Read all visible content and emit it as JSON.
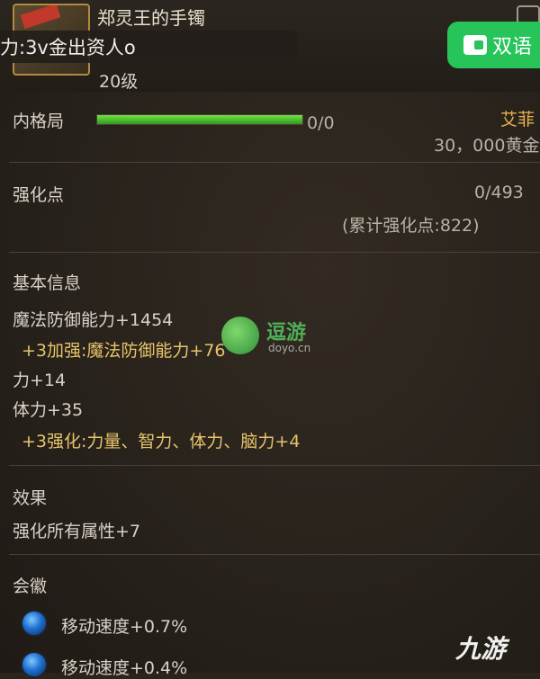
{
  "item": {
    "name": "郑灵王的手镯",
    "level": "20级"
  },
  "overlay": {
    "ad_text": "力:3v金出资人o",
    "translate_label": "双语"
  },
  "inner_pattern": {
    "label": "内格局",
    "progress_text": "0/0",
    "progress_fraction": 1.0
  },
  "merchant": {
    "name": "艾菲",
    "price": "30，000黄金"
  },
  "enhance": {
    "label": "强化点",
    "value": "0/493",
    "cumulative": "(累计强化点:822)"
  },
  "basic_info": {
    "title": "基本信息",
    "stats": [
      "魔法防御能力+1454",
      "+3加强:魔法防御能力+76",
      "力+14",
      "体力+35",
      "+3强化:力量、智力、体力、脑力+4"
    ]
  },
  "effect": {
    "title": "效果",
    "text": "强化所有属性+7"
  },
  "emblem": {
    "title": "会徽",
    "items": [
      "移动速度+0.7%",
      "移动速度+0.4%"
    ]
  },
  "watermarks": {
    "doyo_main": "逗游",
    "doyo_sub": "doyo.cn",
    "nine_you": "九游"
  },
  "colors": {
    "progress_fill": "#4fc72e",
    "bonus_text": "#e6c46a",
    "translate_button": "#27c45a"
  }
}
